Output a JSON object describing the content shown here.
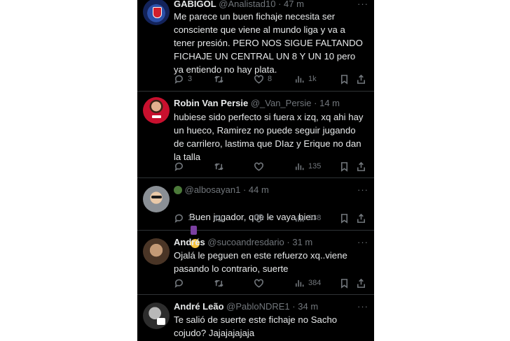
{
  "tweets": [
    {
      "name": "GABIGOL",
      "handle": "@Analistad10",
      "dot": "·",
      "time": "47 m",
      "more": "···",
      "text": "Me parece un buen fichaje necesita ser consciente que viene al mundo liga y va a tener presión. PERO NOS SIGUE FALTANDO FICHAJE UN CENTRAL UN 8 Y UN 10 pero ya entiendo no hay plata.",
      "replies": "3",
      "retweets": "",
      "likes": "8",
      "views": "1k"
    },
    {
      "name": "Robin Van Persie",
      "handle": "@_Van_Persie",
      "dot": "·",
      "time": "14 m",
      "more": "",
      "text": "hubiese sido perfecto si fuera x izq, xq ahi hay un hueco, Ramirez no puede seguir jugando de carrilero, lastima que DIaz y Erique no dan la talla",
      "replies": "",
      "retweets": "",
      "likes": "",
      "views": "135"
    },
    {
      "name": "",
      "handle": "@albosayan1",
      "dot": "·",
      "time": "44 m",
      "more": "···",
      "text": "Buen jugador, que le vaya bien",
      "replies": "1",
      "retweets": "",
      "likes": "4",
      "views": "938"
    },
    {
      "name": "Andrés",
      "handle": "@sucoandresdario",
      "dot": "·",
      "time": "31 m",
      "more": "···",
      "text": "Ojalá le peguen en este refuerzo xq..viene pasando lo contrario, suerte",
      "replies": "",
      "retweets": "",
      "likes": "",
      "views": "384"
    },
    {
      "name": "André Leão",
      "handle": "@PabloNDRE1",
      "dot": "·",
      "time": "34 m",
      "more": "···",
      "text": "Te salió de suerte este fichaje no Sacho cojudo? Jajajajajaja",
      "replies": "",
      "retweets": "",
      "likes": "",
      "views": ""
    }
  ],
  "colors": {
    "background": "#000000",
    "text": "#e7e9ea",
    "muted": "#71767b",
    "divider": "#2f3336"
  }
}
